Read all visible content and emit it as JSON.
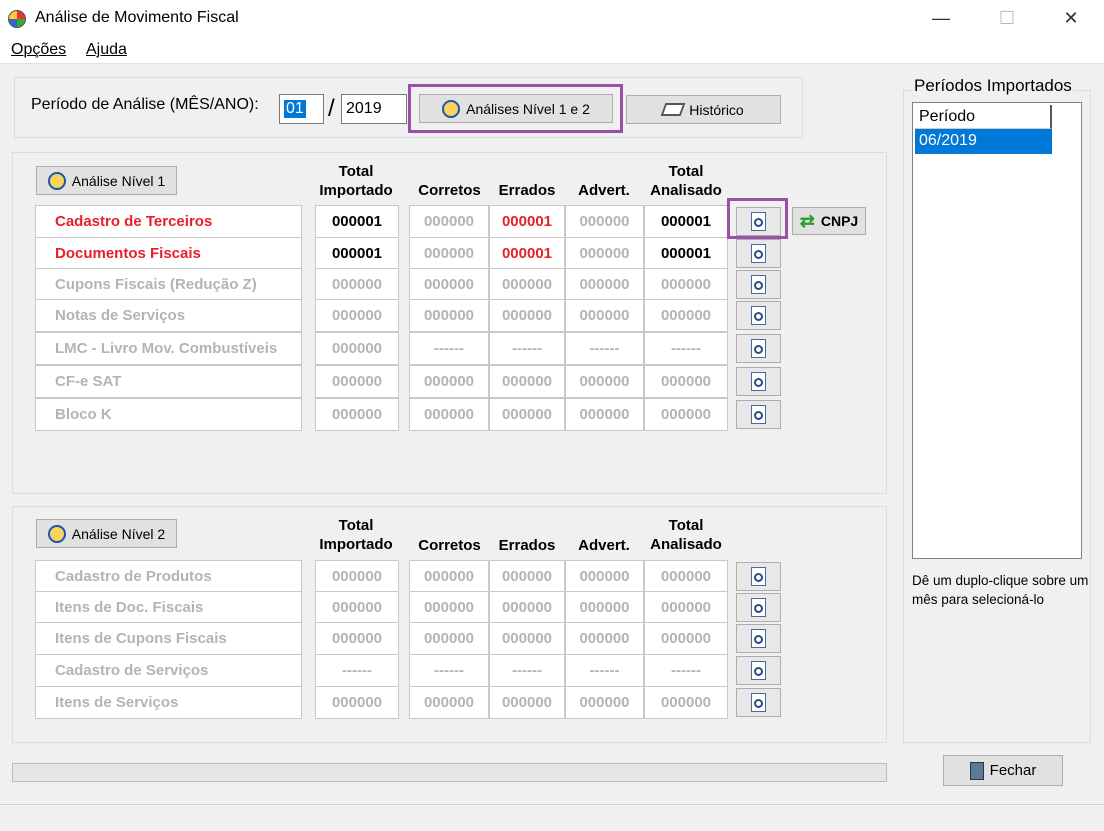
{
  "window": {
    "title": "Análise de Movimento Fiscal"
  },
  "menu": [
    "Opções",
    "Ajuda"
  ],
  "period": {
    "label": "Período de Análise (MÊS/ANO):",
    "month": "01",
    "sep": "/",
    "year": "2019"
  },
  "buttons": {
    "analyze_all": "Análises Nível 1 e 2",
    "history": "Histórico",
    "level1": "Análise Nível 1",
    "level2": "Análise Nível 2",
    "cnpj": "CNPJ",
    "close": "Fechar"
  },
  "headers": {
    "total": "Total",
    "imported": "Importado",
    "correct": "Corretos",
    "errors": "Errados",
    "warn": "Advert.",
    "analyzed": "Analisado"
  },
  "level1_rows": [
    {
      "name": "Cadastro de Terceiros",
      "imported": "000001",
      "correct": "000000",
      "errors": "000001",
      "warn": "000000",
      "analyzed": "000001",
      "active": true
    },
    {
      "name": "Documentos Fiscais",
      "imported": "000001",
      "correct": "000000",
      "errors": "000001",
      "warn": "000000",
      "analyzed": "000001",
      "active": true
    },
    {
      "name": "Cupons Fiscais (Redução Z)",
      "imported": "000000",
      "correct": "000000",
      "errors": "000000",
      "warn": "000000",
      "analyzed": "000000",
      "active": false
    },
    {
      "name": "Notas de Serviços",
      "imported": "000000",
      "correct": "000000",
      "errors": "000000",
      "warn": "000000",
      "analyzed": "000000",
      "active": false
    },
    {
      "name": "LMC - Livro Mov. Combustíveis",
      "imported": "000000",
      "correct": "------",
      "errors": "------",
      "warn": "------",
      "analyzed": "------",
      "active": false
    },
    {
      "name": "CF-e SAT",
      "imported": "000000",
      "correct": "000000",
      "errors": "000000",
      "warn": "000000",
      "analyzed": "000000",
      "active": false
    },
    {
      "name": "Bloco K",
      "imported": "000000",
      "correct": "000000",
      "errors": "000000",
      "warn": "000000",
      "analyzed": "000000",
      "active": false
    }
  ],
  "level2_rows": [
    {
      "name": "Cadastro de Produtos",
      "imported": "000000",
      "correct": "000000",
      "errors": "000000",
      "warn": "000000",
      "analyzed": "000000"
    },
    {
      "name": "Itens de Doc. Fiscais",
      "imported": "000000",
      "correct": "000000",
      "errors": "000000",
      "warn": "000000",
      "analyzed": "000000"
    },
    {
      "name": "Itens de Cupons Fiscais",
      "imported": "000000",
      "correct": "000000",
      "errors": "000000",
      "warn": "000000",
      "analyzed": "000000"
    },
    {
      "name": "Cadastro de Serviços",
      "imported": "------",
      "correct": "------",
      "errors": "------",
      "warn": "------",
      "analyzed": "------"
    },
    {
      "name": "Itens de Serviços",
      "imported": "000000",
      "correct": "000000",
      "errors": "000000",
      "warn": "000000",
      "analyzed": "000000"
    }
  ],
  "imported_periods": {
    "title": "Períodos Importados",
    "column": "Período",
    "items": [
      "06/2019"
    ],
    "hint": "Dê um duplo-clique sobre um mês para selecioná-lo"
  },
  "colors": {
    "error_red": "#e8202a",
    "selection_blue": "#0078d7",
    "highlight_purple": "#9b4fa8"
  }
}
